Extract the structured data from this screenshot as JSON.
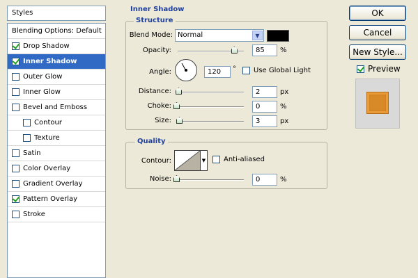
{
  "styles_panel": {
    "header": "Styles",
    "items": [
      {
        "label": "Blending Options: Default",
        "checkbox": false,
        "checked": false,
        "selected": false,
        "sub": false
      },
      {
        "label": "Drop Shadow",
        "checkbox": true,
        "checked": true,
        "selected": false,
        "sub": false
      },
      {
        "label": "Inner Shadow",
        "checkbox": true,
        "checked": true,
        "selected": true,
        "sub": false
      },
      {
        "label": "Outer Glow",
        "checkbox": true,
        "checked": false,
        "selected": false,
        "sub": false
      },
      {
        "label": "Inner Glow",
        "checkbox": true,
        "checked": false,
        "selected": false,
        "sub": false
      },
      {
        "label": "Bevel and Emboss",
        "checkbox": true,
        "checked": false,
        "selected": false,
        "sub": false
      },
      {
        "label": "Contour",
        "checkbox": true,
        "checked": false,
        "selected": false,
        "sub": true
      },
      {
        "label": "Texture",
        "checkbox": true,
        "checked": false,
        "selected": false,
        "sub": true
      },
      {
        "label": "Satin",
        "checkbox": true,
        "checked": false,
        "selected": false,
        "sub": false
      },
      {
        "label": "Color Overlay",
        "checkbox": true,
        "checked": false,
        "selected": false,
        "sub": false
      },
      {
        "label": "Gradient Overlay",
        "checkbox": true,
        "checked": false,
        "selected": false,
        "sub": false
      },
      {
        "label": "Pattern Overlay",
        "checkbox": true,
        "checked": true,
        "selected": false,
        "sub": false
      },
      {
        "label": "Stroke",
        "checkbox": true,
        "checked": false,
        "selected": false,
        "sub": false
      }
    ]
  },
  "inner_shadow": {
    "title": "Inner Shadow",
    "structure": {
      "title": "Structure",
      "blend_mode_label": "Blend Mode:",
      "blend_mode_value": "Normal",
      "shadow_color": "#000000",
      "opacity_label": "Opacity:",
      "opacity_value": "85",
      "opacity_unit": "%",
      "opacity_fraction": 0.85,
      "angle_label": "Angle:",
      "angle_value": "120",
      "angle_unit": "°",
      "angle_degrees": 120,
      "use_global_light_label": "Use Global Light",
      "use_global_light": false,
      "distance_label": "Distance:",
      "distance_value": "2",
      "distance_unit": "px",
      "choke_label": "Choke:",
      "choke_value": "0",
      "choke_unit": "%",
      "size_label": "Size:",
      "size_value": "3",
      "size_unit": "px"
    },
    "quality": {
      "title": "Quality",
      "contour_label": "Contour:",
      "anti_aliased_label": "Anti-aliased",
      "anti_aliased": false,
      "noise_label": "Noise:",
      "noise_value": "0",
      "noise_unit": "%"
    }
  },
  "actions": {
    "ok_label": "OK",
    "cancel_label": "Cancel",
    "new_style_label": "New Style...",
    "preview_label": "Preview",
    "preview_checked": true,
    "preview_color": "#d98a28"
  }
}
